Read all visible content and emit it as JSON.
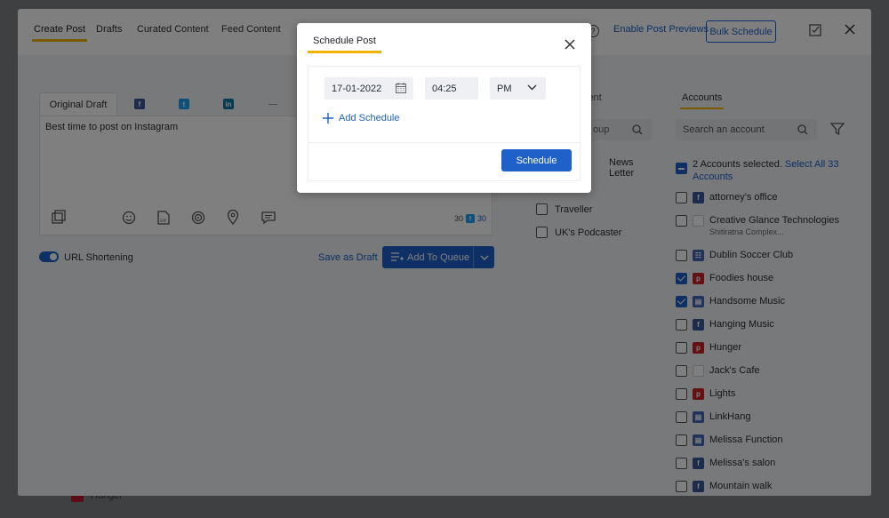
{
  "nav": {
    "tabs": [
      {
        "label": "Create Post"
      },
      {
        "label": "Drafts"
      },
      {
        "label": "Curated Content"
      },
      {
        "label": "Feed Content"
      }
    ],
    "enable_previews": "Enable Post Previews",
    "bulk_schedule": "Bulk Schedule",
    "help": "?"
  },
  "editor": {
    "original_draft_tab": "Original Draft",
    "text": "Best time to post on Instagram",
    "counter_left": "30",
    "counter_right": "30",
    "url_shortening": "URL Shortening",
    "save_as_draft": "Save as Draft",
    "add_to_queue": "Add To Queue"
  },
  "middle": {
    "title": "ient",
    "search_placeholder": "oup",
    "items": [
      {
        "label": "News Letter"
      },
      {
        "label": "Traveller"
      },
      {
        "label": "UK's Podcaster"
      }
    ]
  },
  "accounts": {
    "title": "Accounts",
    "search_placeholder": "Search an account",
    "selected_text": "2 Accounts selected.",
    "select_all": "Select All 33 Accounts",
    "list": [
      {
        "name": "attorney's office",
        "icon": "facebook-icon",
        "checked": false
      },
      {
        "name": "Creative Glance Technologies",
        "sub": "Shitiratna Complex...",
        "icon": "blank-icon",
        "checked": false
      },
      {
        "name": "Dublin Soccer Club",
        "icon": "facebook-group-icon",
        "checked": false
      },
      {
        "name": "Foodies house",
        "icon": "pinterest-icon",
        "checked": true
      },
      {
        "name": "Handsome Music",
        "icon": "business-page-icon",
        "checked": true
      },
      {
        "name": "Hanging Music",
        "icon": "facebook-icon",
        "checked": false
      },
      {
        "name": "Hunger",
        "icon": "pinterest-icon",
        "checked": false
      },
      {
        "name": "Jack's Cafe",
        "icon": "blank-icon",
        "checked": false
      },
      {
        "name": "Lights",
        "icon": "pinterest-icon",
        "checked": false
      },
      {
        "name": "LinkHang",
        "icon": "business-page-icon",
        "checked": false
      },
      {
        "name": "Melissa Function",
        "icon": "business-page-icon",
        "checked": false
      },
      {
        "name": "Melissa's salon",
        "icon": "facebook-icon",
        "checked": false
      },
      {
        "name": "Mountain walk",
        "icon": "facebook-icon",
        "checked": false
      }
    ]
  },
  "background_row": {
    "label": "Hunger"
  },
  "schedule_dialog": {
    "title": "Schedule Post",
    "date": "17-01-2022",
    "time": "04:25",
    "ampm": "PM",
    "add_schedule": "Add Schedule",
    "schedule_button": "Schedule"
  },
  "colors": {
    "primary": "#1f60c9",
    "accent_underline": "#f0b400"
  }
}
